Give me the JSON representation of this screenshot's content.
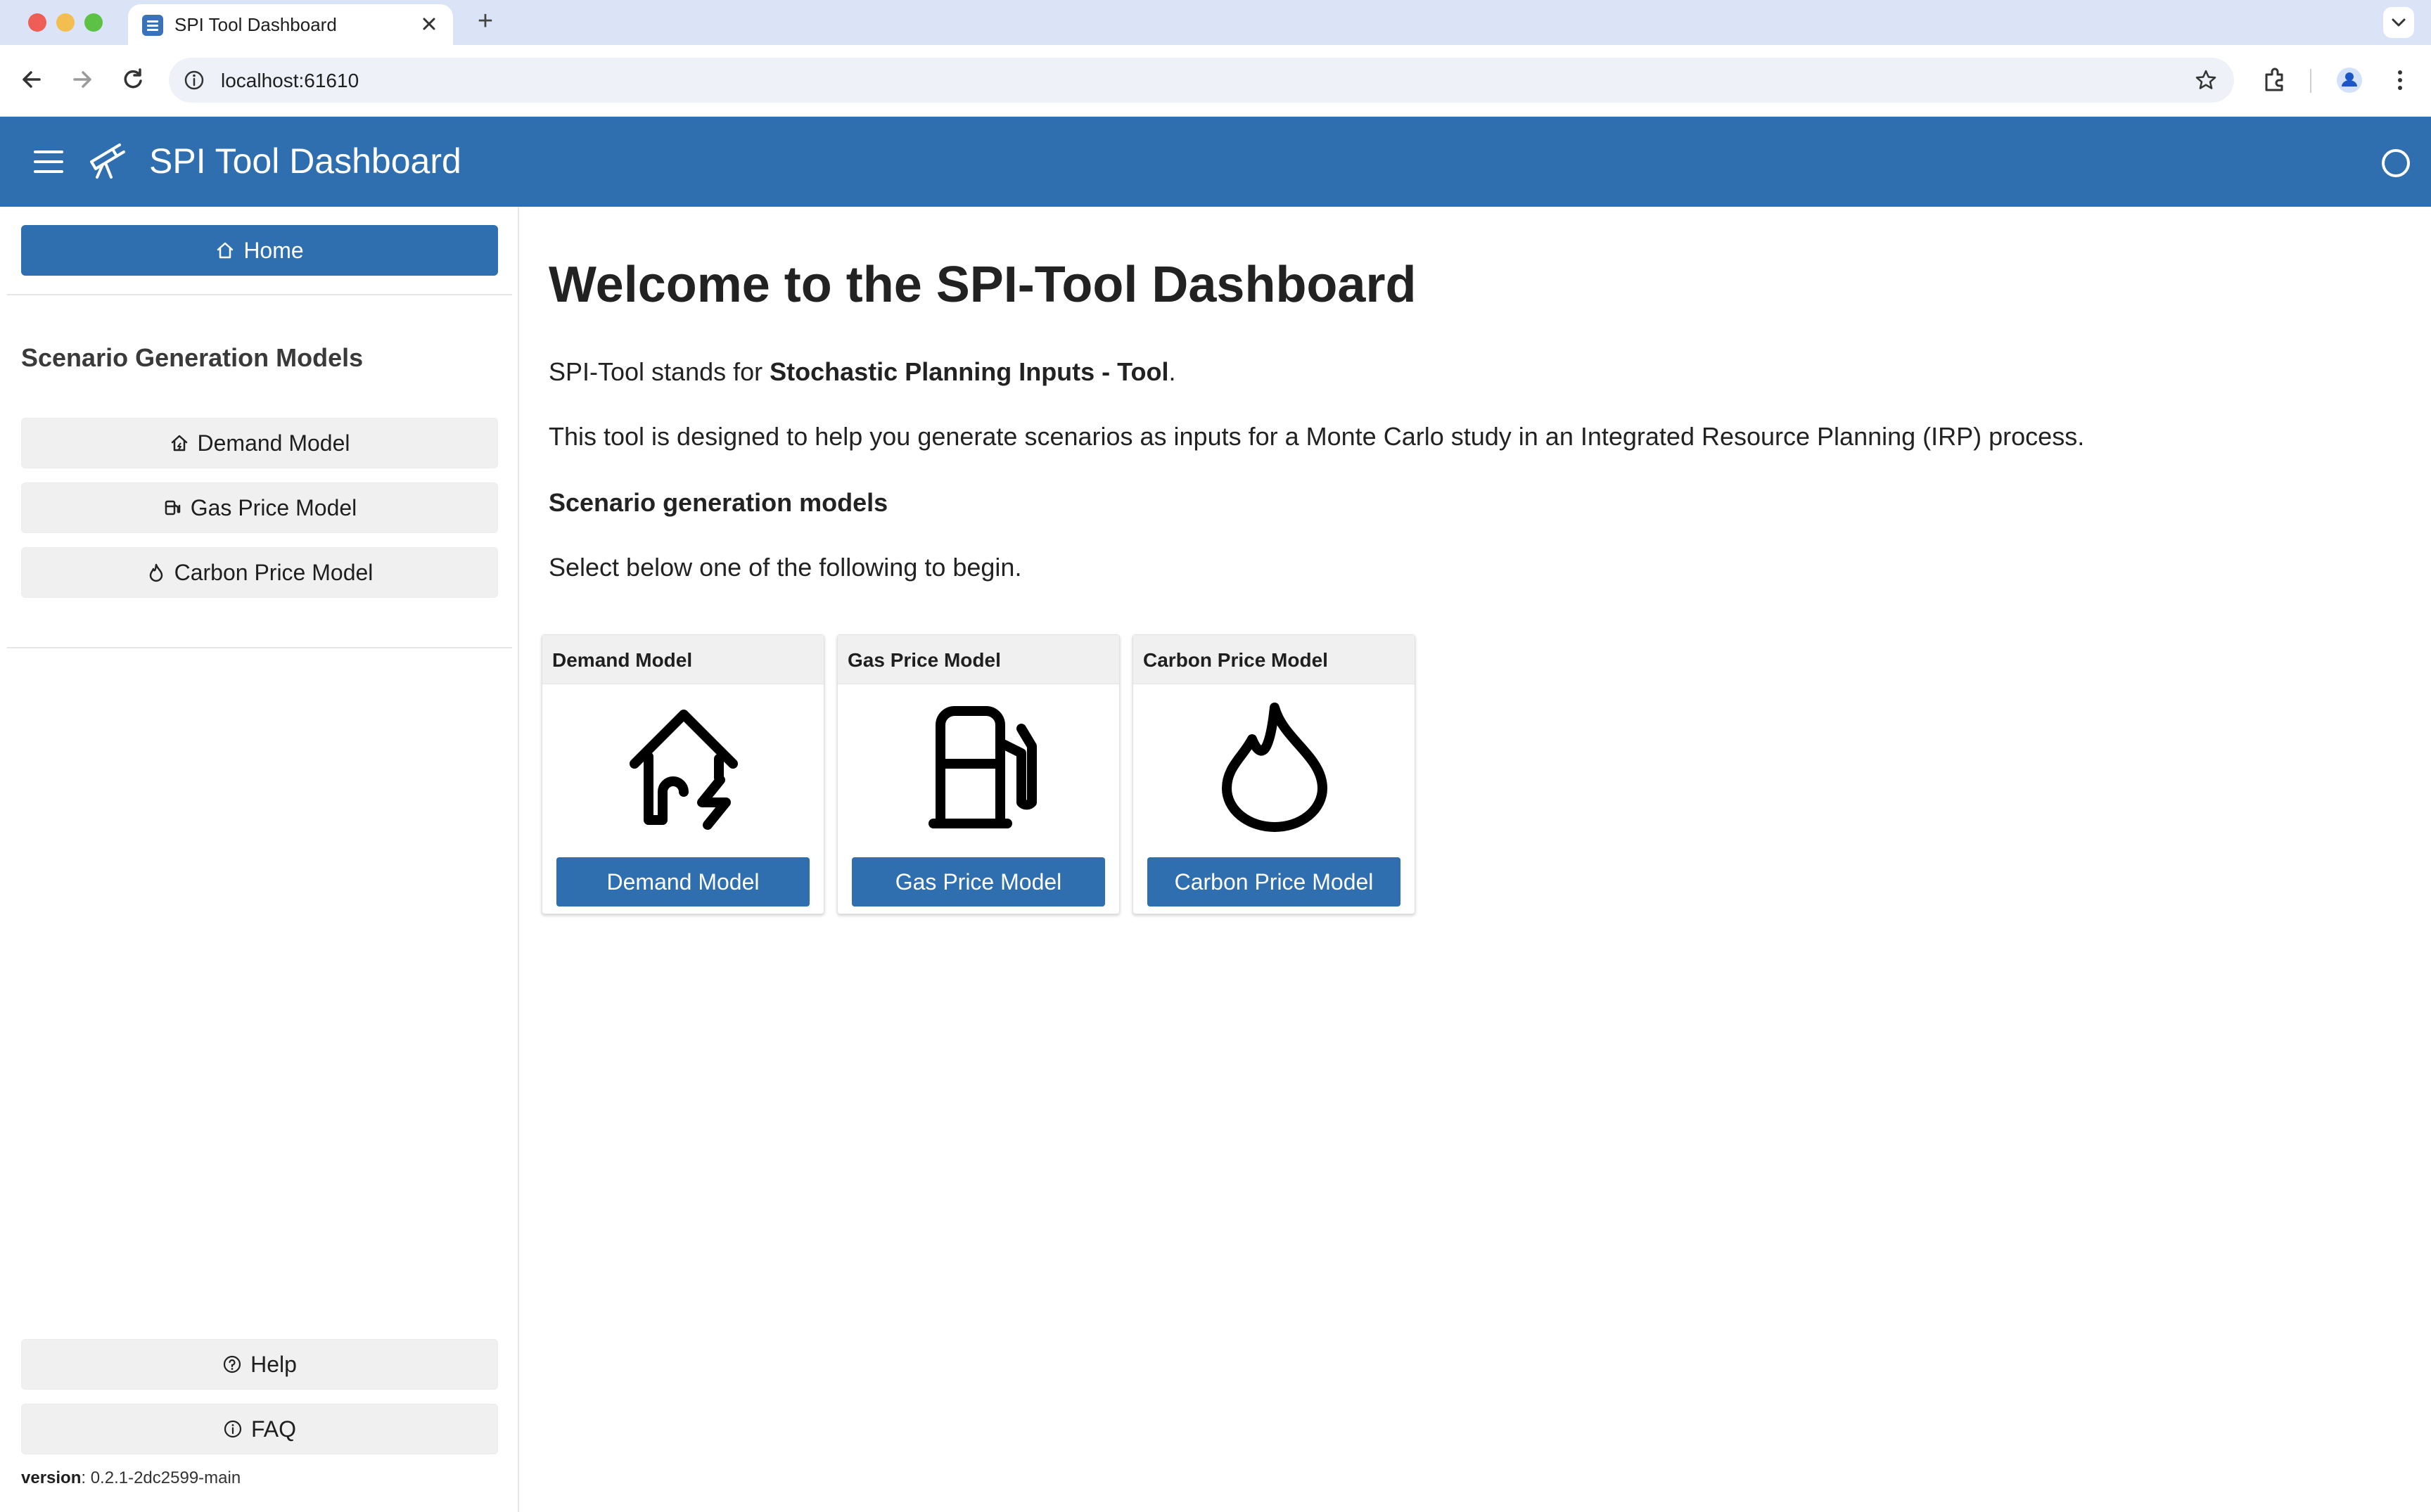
{
  "browser": {
    "tab_title": "SPI Tool Dashboard",
    "url": "localhost:61610",
    "favicon_icon": "list-icon",
    "new_tab_label": "+"
  },
  "app": {
    "title": "SPI Tool Dashboard",
    "brand_color": "#2f6fb0",
    "logo_icon": "telescope-icon"
  },
  "sidebar": {
    "home_label": "Home",
    "section_heading": "Scenario Generation Models",
    "items": [
      {
        "label": "Demand Model",
        "icon": "house-icon"
      },
      {
        "label": "Gas Price Model",
        "icon": "fuel-pump-icon"
      },
      {
        "label": "Carbon Price Model",
        "icon": "flame-icon"
      }
    ],
    "help_label": "Help",
    "faq_label": "FAQ",
    "version_key": "version",
    "version_value": ": 0.2.1-2dc2599-main"
  },
  "main": {
    "title": "Welcome to the SPI-Tool Dashboard",
    "intro_prefix": "SPI-Tool stands for ",
    "intro_bold": "Stochastic Planning Inputs - Tool",
    "intro_suffix": ".",
    "description": "This tool is designed to help you generate scenarios as inputs for a Monte Carlo study in an Integrated Resource Planning (IRP) process.",
    "subheading": "Scenario generation models",
    "instruction": "Select below one of the following to begin.",
    "cards": [
      {
        "title": "Demand Model",
        "button": "Demand Model",
        "icon": "house-lightning-icon"
      },
      {
        "title": "Gas Price Model",
        "button": "Gas Price Model",
        "icon": "fuel-pump-icon"
      },
      {
        "title": "Carbon Price Model",
        "button": "Carbon Price Model",
        "icon": "flame-icon"
      }
    ]
  }
}
